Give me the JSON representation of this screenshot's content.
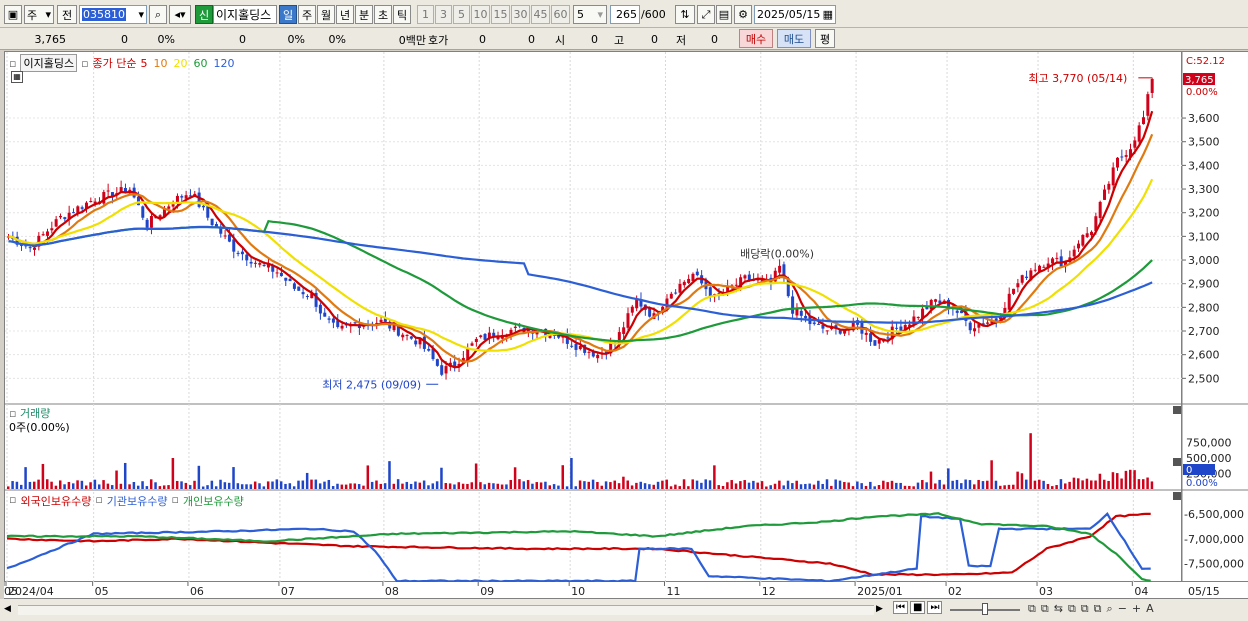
{
  "toolbar": {
    "unit_label": "주",
    "prev_label": "전",
    "code_value": "035810",
    "trade_badge": "신",
    "stock_name": "이지홀딩스",
    "periods": [
      "일",
      "주",
      "월",
      "년",
      "분",
      "초",
      "틱"
    ],
    "active_period": "일",
    "intervals": [
      "1",
      "3",
      "5",
      "10",
      "15",
      "30",
      "45",
      "60"
    ],
    "interval_select": "5",
    "count_value": "265",
    "count_total": "/600",
    "date_value": "2025/05/15"
  },
  "quote": {
    "price": "3,765",
    "change": "0",
    "change_pct": "0%",
    "volume": "0",
    "vol_pct": "0%",
    "extra_pct": "0%",
    "amount": "0백만",
    "hoga_label": "호가",
    "hoga_value": "0",
    "hoga_value2": "0",
    "open_label": "시",
    "open_value": "0",
    "high_label": "고",
    "high_value": "0",
    "low_label": "저",
    "low_value": "0",
    "buy_label": "매수",
    "sell_label": "매도",
    "eval_label": "평"
  },
  "price_panel": {
    "title": "이지홀딩스",
    "legend_prefix": "종가 단순",
    "ma_periods": [
      "5",
      "10",
      "20",
      "60",
      "120"
    ],
    "ma_colors": [
      "#cc0000",
      "#e07a10",
      "#f0e000",
      "#1e9a3a",
      "#2c5fd6"
    ],
    "high_annotation": "최고 3,770 (05/14)",
    "low_annotation": "최저 2,475 (09/09)",
    "dividend_annotation": "배당락(0.00%)",
    "right_top_label": "C:52.12",
    "current_price_tag": "3,765",
    "current_pct_tag": "0.00%",
    "y_ticks": [
      "3,600",
      "3,500",
      "3,400",
      "3,300",
      "3,200",
      "3,100",
      "3,000",
      "2,900",
      "2,800",
      "2,700",
      "2,600",
      "2,500"
    ]
  },
  "volume_panel": {
    "title": "거래량",
    "subtitle": "0주(0.00%)",
    "y_ticks": [
      "750,000",
      "500,000",
      "250,000"
    ],
    "tag_value": "0",
    "tag_pct": "0.00%"
  },
  "holdings_panel": {
    "legend": [
      "외국인보유수량",
      "기관보유수량",
      "개인보유수량"
    ],
    "legend_colors": [
      "#cc0000",
      "#2c5fd6",
      "#1e9a3a"
    ],
    "y_ticks": [
      "-6,500,000",
      "-7,000,000",
      "-7,500,000"
    ]
  },
  "x_axis": {
    "labels": [
      "2024/04",
      "05",
      "06",
      "07",
      "08",
      "09",
      "10",
      "11",
      "12",
      "2025/01",
      "02",
      "03",
      "04",
      "05"
    ],
    "right_label": "05/15"
  },
  "chart_data": [
    {
      "type": "line",
      "title": "이지홀딩스",
      "ylim": [
        2400,
        3820
      ],
      "series": [
        {
          "name": "종가 단순 5",
          "color": "#cc0000"
        },
        {
          "name": "종가 단순 10",
          "color": "#e07a10"
        },
        {
          "name": "종가 단순 20",
          "color": "#f0e000"
        },
        {
          "name": "종가 단순 60",
          "color": "#1e9a3a"
        },
        {
          "name": "종가 단순 120",
          "color": "#2c5fd6"
        }
      ],
      "close_keypoints": [
        [
          0,
          3100
        ],
        [
          5,
          3050
        ],
        [
          12,
          3180
        ],
        [
          20,
          3260
        ],
        [
          28,
          3300
        ],
        [
          32,
          3150
        ],
        [
          38,
          3250
        ],
        [
          42,
          3290
        ],
        [
          46,
          3180
        ],
        [
          52,
          3050
        ],
        [
          58,
          2980
        ],
        [
          62,
          2950
        ],
        [
          66,
          2880
        ],
        [
          70,
          2850
        ],
        [
          73,
          2750
        ],
        [
          76,
          2700
        ],
        [
          80,
          2730
        ],
        [
          86,
          2740
        ],
        [
          90,
          2700
        ],
        [
          95,
          2650
        ],
        [
          100,
          2530
        ],
        [
          103,
          2560
        ],
        [
          108,
          2660
        ],
        [
          114,
          2700
        ],
        [
          120,
          2710
        ],
        [
          126,
          2690
        ],
        [
          131,
          2640
        ],
        [
          136,
          2600
        ],
        [
          140,
          2650
        ],
        [
          145,
          2830
        ],
        [
          149,
          2760
        ],
        [
          152,
          2850
        ],
        [
          158,
          2940
        ],
        [
          163,
          2840
        ],
        [
          170,
          2920
        ],
        [
          176,
          2900
        ],
        [
          178,
          2970
        ],
        [
          181,
          2790
        ],
        [
          186,
          2720
        ],
        [
          190,
          2700
        ],
        [
          196,
          2720
        ],
        [
          200,
          2650
        ],
        [
          204,
          2700
        ],
        [
          208,
          2740
        ],
        [
          214,
          2830
        ],
        [
          218,
          2800
        ],
        [
          222,
          2720
        ],
        [
          228,
          2750
        ],
        [
          232,
          2880
        ],
        [
          236,
          2960
        ],
        [
          240,
          3000
        ],
        [
          244,
          2990
        ],
        [
          247,
          3080
        ],
        [
          250,
          3130
        ],
        [
          253,
          3280
        ],
        [
          256,
          3420
        ],
        [
          259,
          3480
        ],
        [
          262,
          3600
        ],
        [
          264,
          3765
        ]
      ],
      "high": {
        "value": 3770,
        "date": "05/14"
      },
      "low": {
        "value": 2475,
        "date": "09/09"
      }
    },
    {
      "type": "bar",
      "title": "거래량",
      "ylim": [
        0,
        1000000
      ]
    },
    {
      "type": "line",
      "title": "보유수량",
      "ylim": [
        -7850000,
        -6300000
      ],
      "series": [
        {
          "name": "외국인보유수량",
          "color": "#cc0000",
          "keypoints": [
            [
              0,
              -7000000
            ],
            [
              20,
              -7050000
            ],
            [
              40,
              -7000000
            ],
            [
              60,
              -7080000
            ],
            [
              80,
              -7150000
            ],
            [
              120,
              -7200000
            ],
            [
              150,
              -7200000
            ],
            [
              170,
              -7350000
            ],
            [
              190,
              -7500000
            ],
            [
              200,
              -7720000
            ],
            [
              220,
              -7720000
            ],
            [
              232,
              -7680000
            ],
            [
              240,
              -7200000
            ],
            [
              250,
              -6950000
            ],
            [
              256,
              -6550000
            ],
            [
              264,
              -6500000
            ]
          ]
        },
        {
          "name": "기관보유수량",
          "color": "#2c5fd6",
          "keypoints": [
            [
              0,
              -7600000
            ],
            [
              20,
              -6900000
            ],
            [
              50,
              -6850000
            ],
            [
              70,
              -6800000
            ],
            [
              80,
              -6850000
            ],
            [
              85,
              -7250000
            ],
            [
              90,
              -7850000
            ],
            [
              130,
              -7850000
            ],
            [
              145,
              -7850000
            ],
            [
              146,
              -7200000
            ],
            [
              158,
              -7200000
            ],
            [
              162,
              -7750000
            ],
            [
              190,
              -7850000
            ],
            [
              210,
              -7600000
            ],
            [
              211,
              -6550000
            ],
            [
              220,
              -6600000
            ],
            [
              222,
              -7550000
            ],
            [
              227,
              -7550000
            ],
            [
              229,
              -6800000
            ],
            [
              250,
              -6800000
            ],
            [
              254,
              -6500000
            ],
            [
              262,
              -7600000
            ],
            [
              264,
              -7600000
            ]
          ]
        },
        {
          "name": "개인보유수량",
          "color": "#1e9a3a",
          "keypoints": [
            [
              0,
              -6950000
            ],
            [
              30,
              -6950000
            ],
            [
              60,
              -7050000
            ],
            [
              90,
              -6900000
            ],
            [
              130,
              -6850000
            ],
            [
              150,
              -6950000
            ],
            [
              170,
              -6750000
            ],
            [
              190,
              -6650000
            ],
            [
              200,
              -6550000
            ],
            [
              215,
              -6500000
            ],
            [
              225,
              -6700000
            ],
            [
              240,
              -6750000
            ],
            [
              250,
              -6900000
            ],
            [
              256,
              -7300000
            ],
            [
              262,
              -7800000
            ],
            [
              264,
              -7850000
            ]
          ]
        }
      ]
    }
  ]
}
